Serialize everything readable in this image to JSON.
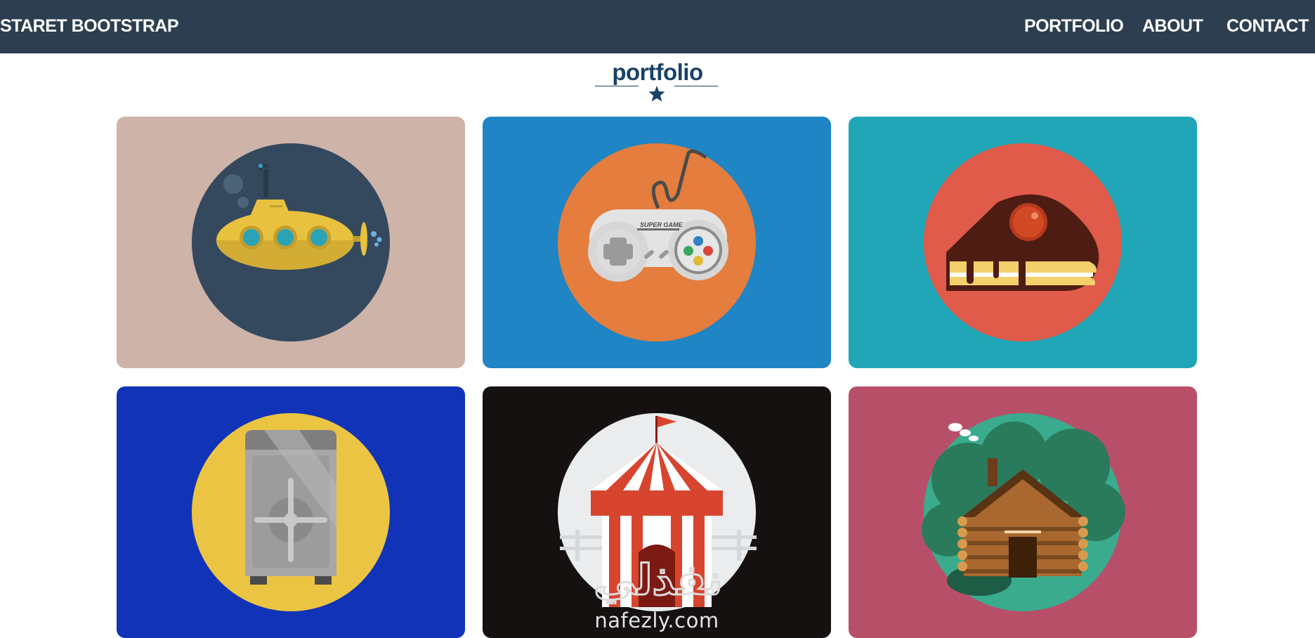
{
  "navbar": {
    "brand": "STARET BOOTSTRAP",
    "links": [
      "PORTFOLIO",
      "ABOUT",
      "CONTACT"
    ],
    "background": "#2c3e50"
  },
  "section": {
    "heading": "portfolio",
    "accent": "#1a4268",
    "divider_icon": "star-icon"
  },
  "portfolio_items": [
    {
      "icon": "submarine-icon",
      "background": "#cdb3a8",
      "circle": "#34495e"
    },
    {
      "icon": "game-controller-icon",
      "background": "#1f85c4",
      "circle": "#e47d3d",
      "controller_text": "SUPER GAME"
    },
    {
      "icon": "cake-slice-icon",
      "background": "#21a6b8",
      "circle": "#e05b4a"
    },
    {
      "icon": "safe-icon",
      "background": "#1033b8",
      "circle": "#ebc443"
    },
    {
      "icon": "circus-tent-icon",
      "background": "#141110",
      "circle": "#eaeced"
    },
    {
      "icon": "log-cabin-icon",
      "background": "#b84f69",
      "circle": "#3aab8d"
    }
  ],
  "watermark": {
    "arabic": "نفذلي",
    "latin": "nafezly.com"
  }
}
